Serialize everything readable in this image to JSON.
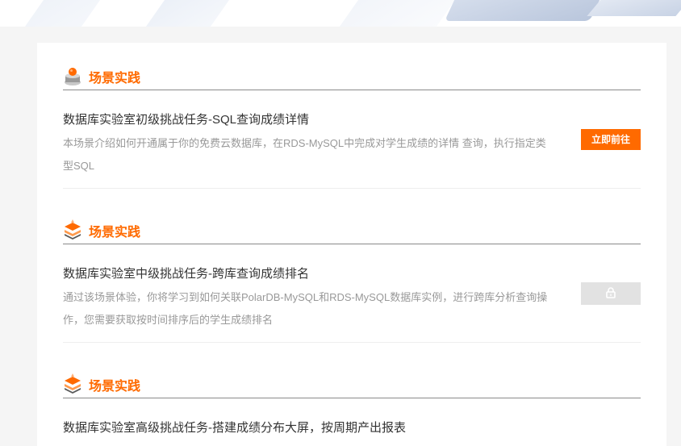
{
  "sections": [
    {
      "heading": "场景实践",
      "icon": "sphere-icon",
      "title": "数据库实验室初级挑战任务-SQL查询成绩详情",
      "description": "本场景介绍如何开通属于你的免费云数据库，在RDS-MySQL中完成对学生成绩的详情 查询，执行指定类型SQL",
      "action": {
        "label": "立即前往",
        "state": "enabled"
      }
    },
    {
      "heading": "场景实践",
      "icon": "layers-icon",
      "title": "数据库实验室中级挑战任务-跨库查询成绩排名",
      "description": "通过该场景体验，你将学习到如何关联PolarDB-MySQL和RDS-MySQL数据库实例，进行跨库分析查询操作，您需要获取按时间排序后的学生成绩排名",
      "action": {
        "label": "",
        "state": "locked",
        "icon": "lock-icon"
      }
    },
    {
      "heading": "场景实践",
      "icon": "layers-icon",
      "title": "数据库实验室高级挑战任务-搭建成绩分布大屏，按周期产出报表",
      "description": "",
      "action": null
    }
  ],
  "colors": {
    "accent": "#ff6a00",
    "locked": "#e2e2e2",
    "title": "#333333",
    "description": "#999999"
  }
}
